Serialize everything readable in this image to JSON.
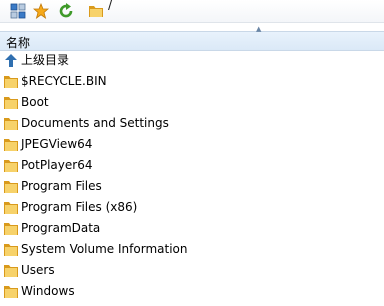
{
  "toolbar": {
    "view_icon": "view-toggle-icon",
    "favorite_icon": "star-icon",
    "refresh_icon": "refresh-icon",
    "folder_icon": "folder-icon",
    "path": "/"
  },
  "column_header": {
    "name_label": "名称",
    "sort_indicator": "▲"
  },
  "parent_dir": {
    "label": "上级目录",
    "icon": "up-arrow-icon"
  },
  "items": [
    {
      "name": "$RECYCLE.BIN",
      "icon": "folder-icon"
    },
    {
      "name": "Boot",
      "icon": "folder-icon"
    },
    {
      "name": "Documents and Settings",
      "icon": "folder-icon"
    },
    {
      "name": "JPEGView64",
      "icon": "folder-icon"
    },
    {
      "name": "PotPlayer64",
      "icon": "folder-icon"
    },
    {
      "name": "Program Files",
      "icon": "folder-icon"
    },
    {
      "name": "Program Files (x86)",
      "icon": "folder-icon"
    },
    {
      "name": "ProgramData",
      "icon": "folder-icon"
    },
    {
      "name": "System Volume Information",
      "icon": "folder-icon"
    },
    {
      "name": "Users",
      "icon": "folder-icon"
    },
    {
      "name": "Windows",
      "icon": "folder-icon"
    }
  ],
  "colors": {
    "folder_dark": "#d99a1c",
    "folder_light": "#f7d26a",
    "header_bg": "#dbe9f7",
    "up_arrow": "#2f6fb0"
  }
}
